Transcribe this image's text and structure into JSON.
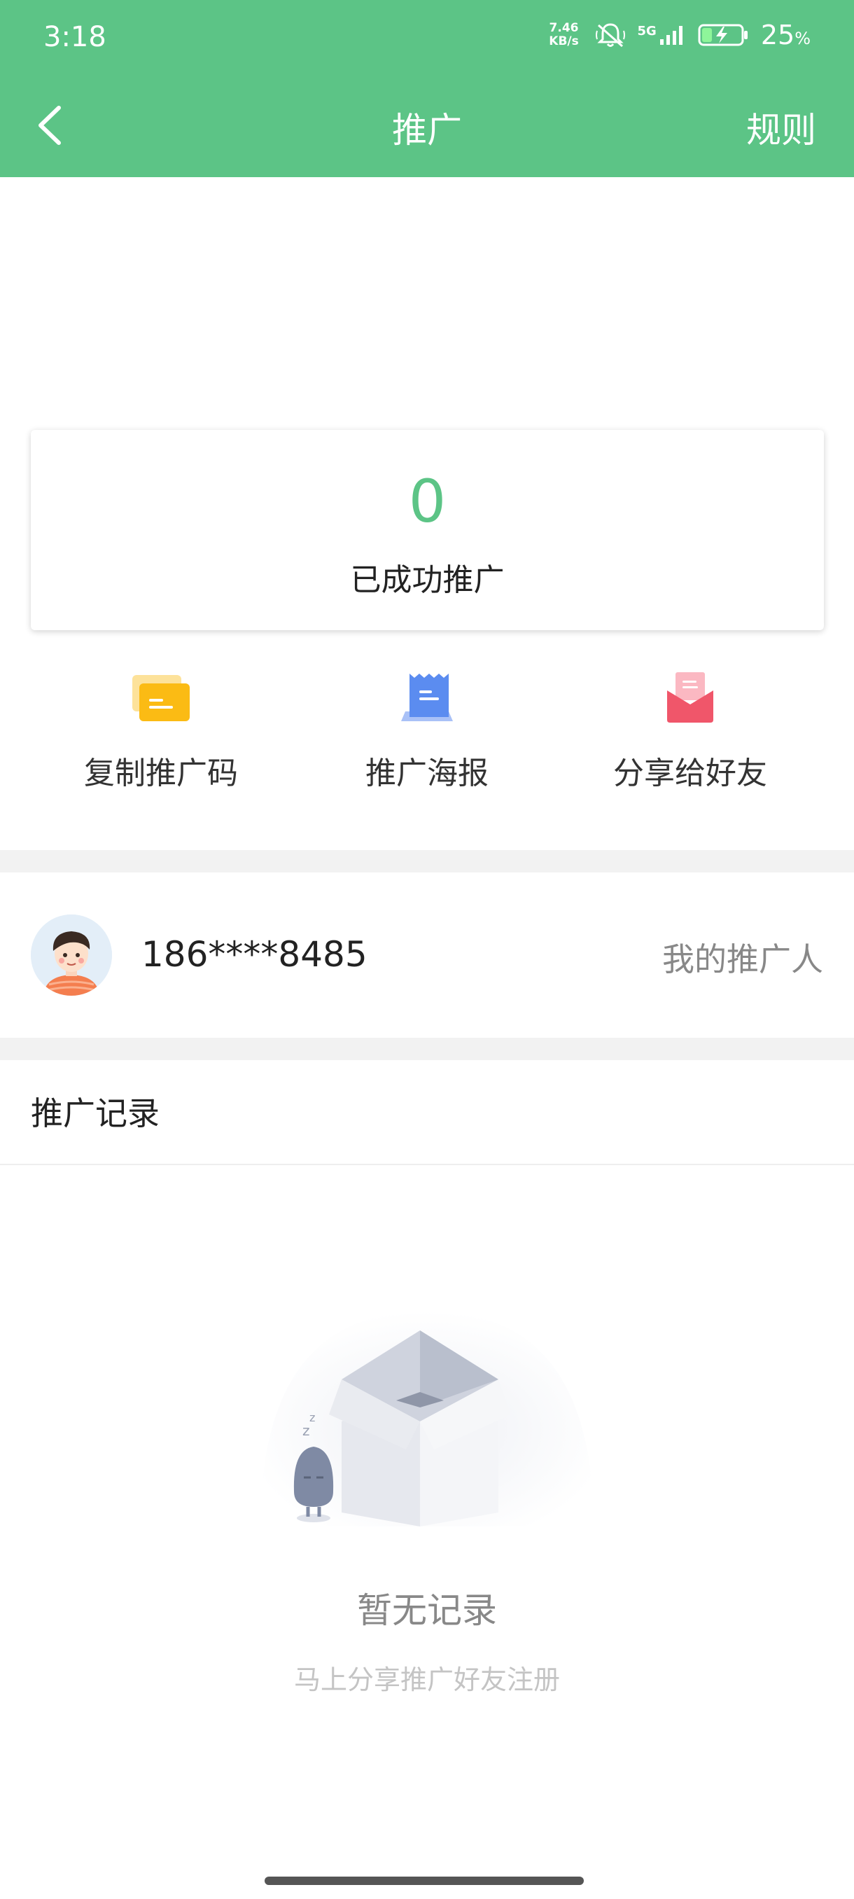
{
  "status_bar": {
    "time": "3:18",
    "net_speed_value": "7.46",
    "net_speed_unit": "KB/s",
    "network": "5G",
    "battery_percent": "25",
    "battery_unit": "%"
  },
  "nav": {
    "back_icon": "chevron-left-icon",
    "title": "推广",
    "rules_label": "规则"
  },
  "stats": {
    "success_count": "0",
    "success_label": "已成功推广"
  },
  "actions": [
    {
      "label": "复制推广码",
      "icon": "promo-code-card-icon",
      "color": "#fbbb14"
    },
    {
      "label": "推广海报",
      "icon": "poster-icon",
      "color": "#5b8cf0"
    },
    {
      "label": "分享给好友",
      "icon": "share-envelope-icon",
      "color": "#f0566a"
    }
  ],
  "inviter": {
    "phone": "186****8485",
    "label": "我的推广人"
  },
  "records": {
    "title": "推广记录",
    "empty_title": "暂无记录",
    "empty_subtitle": "马上分享推广好友注册"
  },
  "colors": {
    "brand_green": "#5cc486",
    "divider_gray": "#f2f2f2"
  }
}
